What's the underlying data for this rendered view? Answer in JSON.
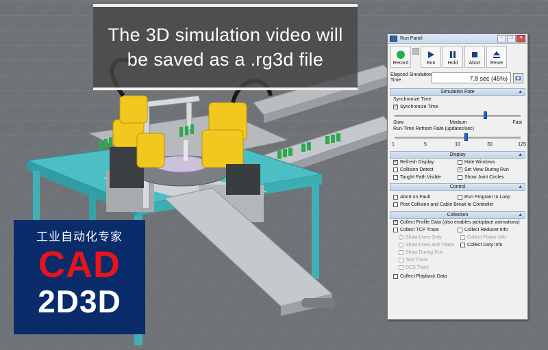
{
  "caption": {
    "line1": "The 3D simulation video will",
    "line2": "be saved as a .rg3d file"
  },
  "watermark": {
    "subtitle": "工业自动化专家",
    "title": "CAD",
    "subtitle2": "2D3D"
  },
  "colors": {
    "viewport_bg": "#6f7377",
    "robot_yellow": "#f2c81e",
    "table_teal": "#3fb1b6",
    "accent_blue": "#1e6fd0",
    "badge_blue": "#0a2c6b",
    "badge_red": "#e8141b"
  },
  "run_panel": {
    "title": "Run Panel",
    "toolbar": [
      {
        "label": "Record",
        "icon": "record-icon"
      },
      {
        "label": "Run",
        "icon": "play-icon"
      },
      {
        "label": "Hold",
        "icon": "pause-icon"
      },
      {
        "label": "Abort",
        "icon": "stop-icon"
      },
      {
        "label": "Reset",
        "icon": "eject-icon"
      }
    ],
    "elapsed_label": "Elapsed Simulation Time",
    "elapsed_value": "7.8 sec (45%)",
    "sim_rate": {
      "header": "Simulation Rate",
      "sync_label": "Synchronize Time",
      "sync_checkbox": "Synchronize Time",
      "sync_checked": true,
      "speed_level": 0.72,
      "speed_ticks": [
        "Slow",
        "Medium",
        "Fast"
      ],
      "refresh_label": "Run-Time Refresh Rate (updates/sec)",
      "refresh_value": 15,
      "refresh_ticks": [
        "1",
        "5",
        "10",
        "30",
        "125"
      ]
    },
    "display": {
      "header": "Display",
      "options": [
        {
          "label": "Refresh Display",
          "checked": true
        },
        {
          "label": "Hide Windows",
          "checked": false
        },
        {
          "label": "Collision Detect",
          "checked": false
        },
        {
          "label": "Set View During Run",
          "checked": true
        },
        {
          "label": "Taught Path Visible",
          "checked": false
        },
        {
          "label": "Show Joint Circles",
          "checked": false
        }
      ]
    },
    "control": {
      "header": "Control",
      "options": [
        {
          "label": "Abort on Fault",
          "checked": false
        },
        {
          "label": "Run Program In Loop",
          "checked": false
        },
        {
          "label": "Post Collision and Cable Break to Controller",
          "checked": false
        }
      ]
    },
    "collection": {
      "header": "Collection",
      "profile": "Collect Profile Data (also enables pick/place animations)",
      "profile_checked": true,
      "tcp": "Collect TCP Trace",
      "reducer": "Collect Reducer Info",
      "power": "Collect Power Info",
      "duty": "Collect Duty Info",
      "radio_options": [
        "Show Lines Only",
        "Show Lines and Triads",
        "Show During Run"
      ],
      "tool_trace": "Tool Trace",
      "dcs_trace": "DCS Trace",
      "playback": "Collect Playback Data"
    }
  }
}
